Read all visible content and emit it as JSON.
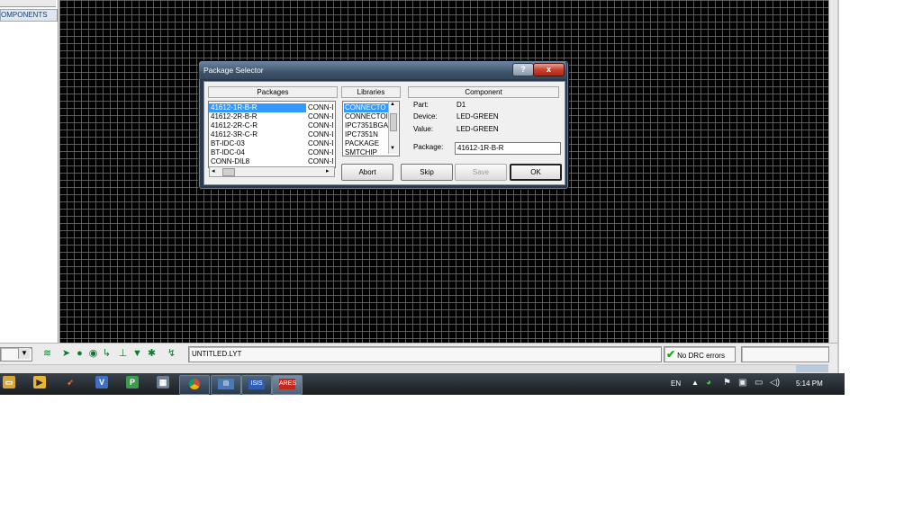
{
  "app": {
    "left_panel": {
      "components_tab": "OMPONENTS"
    },
    "status": {
      "filename": "UNTITLED.LYT",
      "drc": "No DRC errors"
    }
  },
  "dialog": {
    "title": "Package Selector",
    "help": "?",
    "close": "x",
    "packages_header": "Packages",
    "libraries_header": "Libraries",
    "component_header": "Component",
    "packages": [
      {
        "name": "41612-1R-B-R",
        "lib": "CONN-D",
        "selected": true
      },
      {
        "name": "41612-2R-B-R",
        "lib": "CONN-D"
      },
      {
        "name": "41612-2R-C-R",
        "lib": "CONN-D"
      },
      {
        "name": "41612-3R-C-R",
        "lib": "CONN-D"
      },
      {
        "name": "BT-IDC-03",
        "lib": "CONN-D"
      },
      {
        "name": "BT-IDC-04",
        "lib": "CONN-D"
      },
      {
        "name": "CONN-DIL8",
        "lib": "CONN-D"
      }
    ],
    "libraries": [
      {
        "name": "CONNECTO",
        "selected": true
      },
      {
        "name": "CONNECTOI"
      },
      {
        "name": "IPC7351BGA"
      },
      {
        "name": "IPC7351N"
      },
      {
        "name": "PACKAGE"
      },
      {
        "name": "SMTCHIP"
      }
    ],
    "component": {
      "part_label": "Part:",
      "part": "D1",
      "device_label": "Device:",
      "device": "LED-GREEN",
      "value_label": "Value:",
      "value": "LED-GREEN",
      "package_label": "Package:",
      "package": "41612-1R-B-R"
    },
    "buttons": {
      "abort": "Abort",
      "skip": "Skip",
      "save": "Save",
      "ok": "OK"
    }
  },
  "taskbar": {
    "language": "EN",
    "time": "5:14 PM",
    "apps": [
      "explorer",
      "media-player",
      "matlab",
      "visio",
      "publisher",
      "task-manager",
      "chrome",
      "isis-window",
      "isis",
      "ares"
    ]
  }
}
